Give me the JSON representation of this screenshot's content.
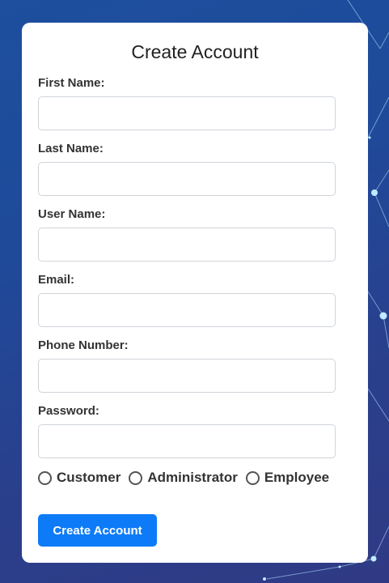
{
  "form": {
    "title": "Create Account",
    "fields": [
      {
        "label": "First Name:",
        "value": "",
        "placeholder": ""
      },
      {
        "label": "Last Name:",
        "value": "",
        "placeholder": ""
      },
      {
        "label": "User Name:",
        "value": "",
        "placeholder": ""
      },
      {
        "label": "Email:",
        "value": "",
        "placeholder": ""
      },
      {
        "label": "Phone Number:",
        "value": "",
        "placeholder": ""
      },
      {
        "label": "Password:",
        "value": "",
        "placeholder": ""
      }
    ],
    "roles": [
      {
        "label": "Customer",
        "checked": false
      },
      {
        "label": "Administrator",
        "checked": false
      },
      {
        "label": "Employee",
        "checked": false
      }
    ],
    "submit_label": "Create Account"
  },
  "colors": {
    "background": "#1f4a9a",
    "card": "#ffffff",
    "button": "#0d7bf7"
  }
}
